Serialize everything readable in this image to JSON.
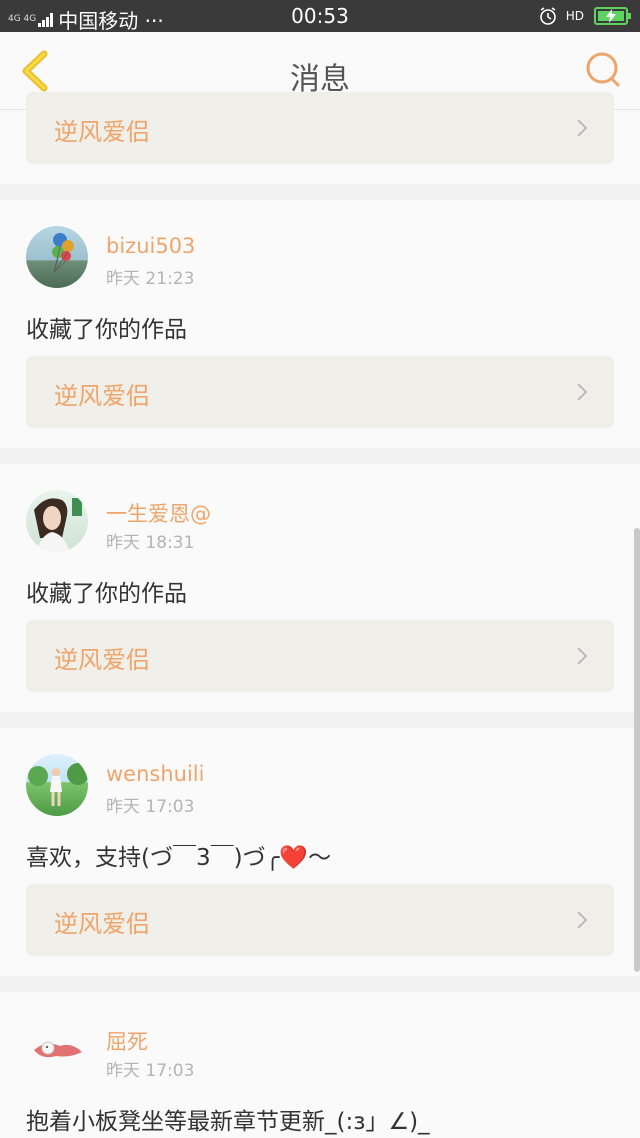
{
  "status_bar": {
    "network": "4G 4G",
    "carrier": "中国移动 ···",
    "time": "00:53",
    "hd": "HD"
  },
  "header": {
    "title": "消息",
    "back_icon": "chevron-left-icon",
    "search_icon": "search-icon"
  },
  "colors": {
    "accent": "#f0a46a",
    "back_icon": "#f5c518",
    "battery": "#5fd35f"
  },
  "top_partial_card": {
    "work_title": "逆风爱侣"
  },
  "messages": [
    {
      "username": "bizui503",
      "time": "昨天 21:23",
      "text": "收藏了你的作品",
      "work_title": "逆风爱侣"
    },
    {
      "username": "一生爱恩@",
      "time": "昨天 18:31",
      "text": "收藏了你的作品",
      "work_title": "逆风爱侣"
    },
    {
      "username": "wenshuili",
      "time": "昨天 17:03",
      "text": "喜欢，支持(づ￣3￣)づ╭❤️～",
      "work_title": "逆风爱侣"
    },
    {
      "username": "屈死",
      "time": "昨天 17:03",
      "text": "抱着小板凳坐等最新章节更新_(:з」∠)_"
    }
  ]
}
